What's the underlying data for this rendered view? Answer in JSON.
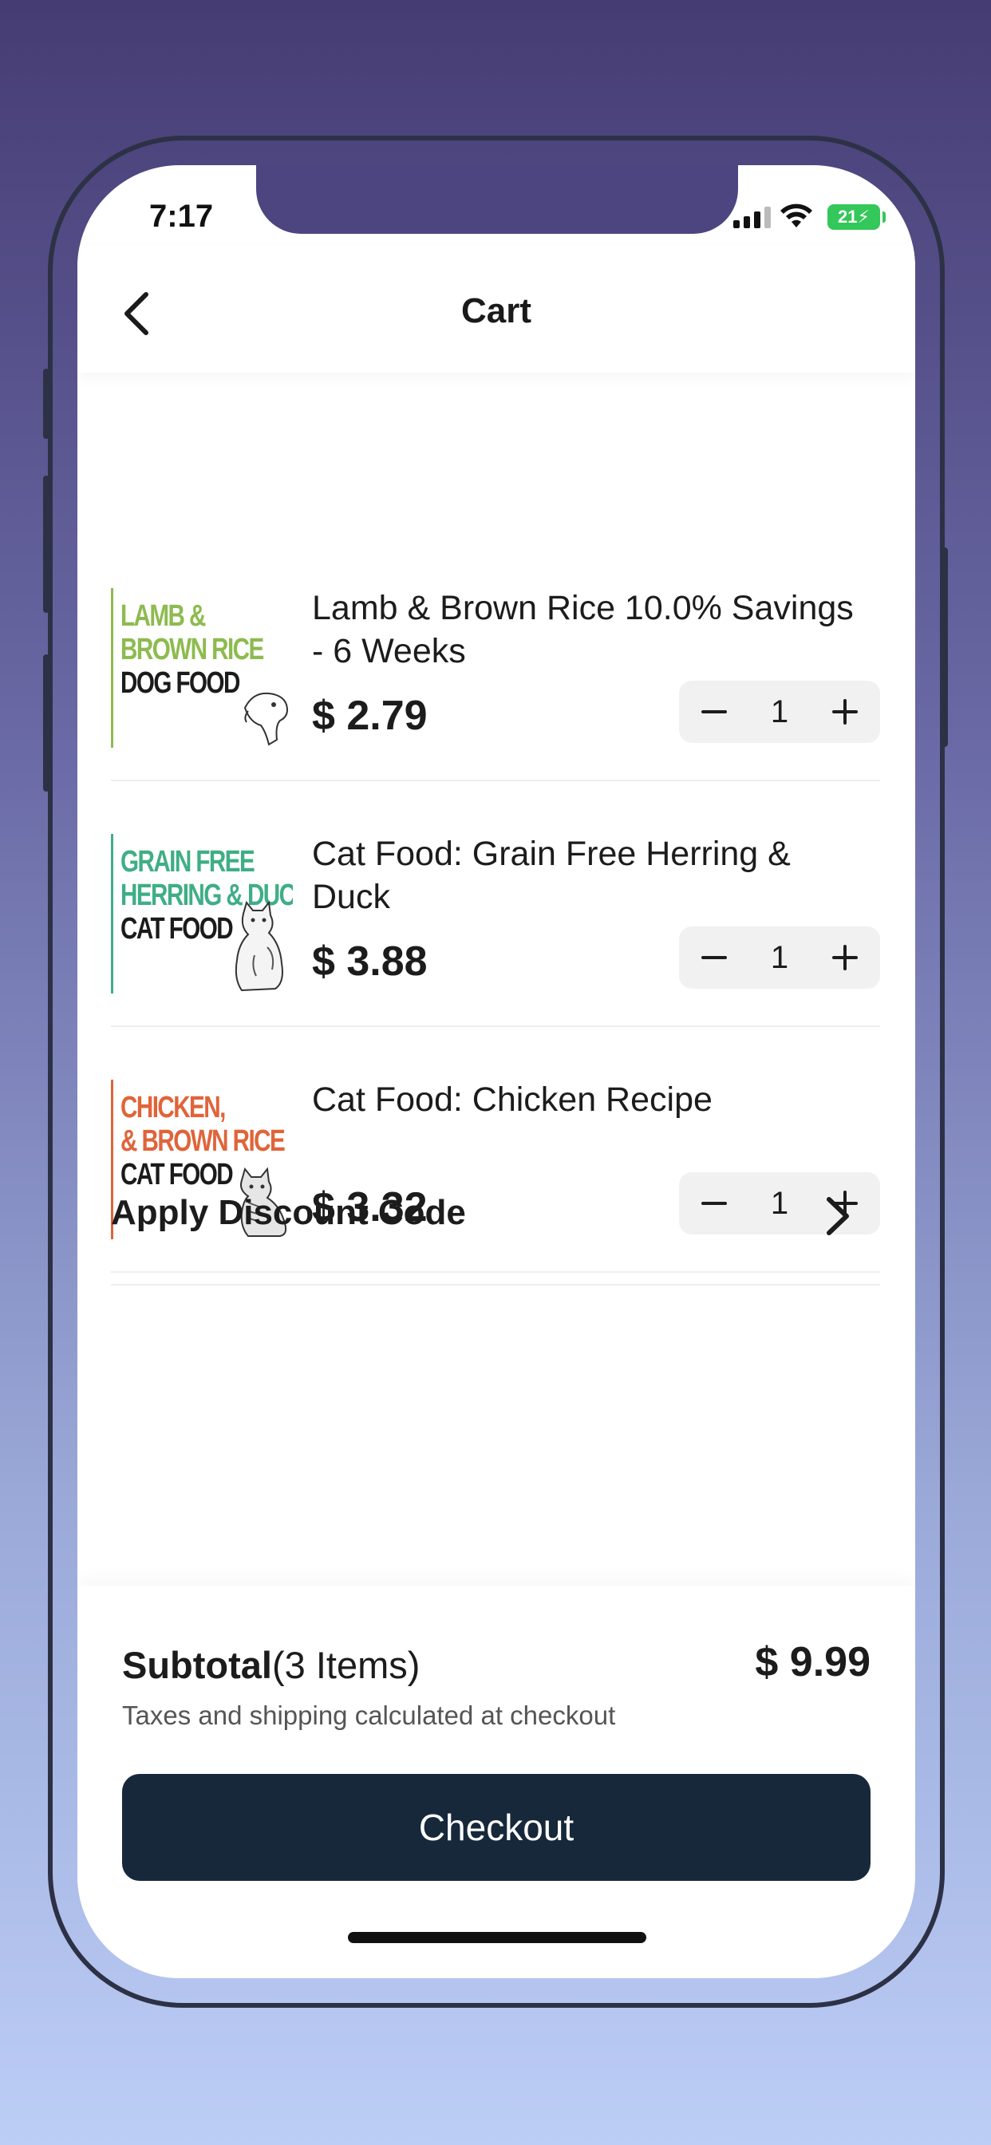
{
  "status_bar": {
    "time": "7:17",
    "battery": "21",
    "signal_icon": "cellular-signal-icon",
    "wifi_icon": "wifi-icon"
  },
  "nav": {
    "title": "Cart",
    "back_icon": "chevron-left-icon"
  },
  "cart_items": [
    {
      "name": "Lamb & Brown Rice 10.0% Savings - 6 Weeks",
      "price": "$ 2.79",
      "quantity": "1",
      "thumb": {
        "line1": "LAMB &",
        "line2": "BROWN RICE",
        "line3": "DOG FOOD",
        "accent": "#8dbb4f",
        "animal": "dog"
      }
    },
    {
      "name": "Cat Food: Grain Free Herring & Duck",
      "price": "$ 3.88",
      "quantity": "1",
      "thumb": {
        "line1": "GRAIN FREE",
        "line2": "HERRING & DUC",
        "line3": "CAT FOOD",
        "accent": "#3fae86",
        "animal": "cat"
      }
    },
    {
      "name": "Cat Food: Chicken Recipe",
      "price": "$ 3.32",
      "quantity": "1",
      "thumb": {
        "line1": "CHICKEN,",
        "line2": "& BROWN RICE",
        "line3": "CAT FOOD",
        "accent": "#e0643a",
        "animal": "cat"
      }
    }
  ],
  "discount": {
    "label": "Apply Discount Code",
    "icon": "chevron-right-icon"
  },
  "summary": {
    "subtotal_label": "Subtotal",
    "item_count": "(3 Items)",
    "subtotal_amount": "$ 9.99",
    "tax_note": "Taxes and shipping calculated at checkout",
    "checkout_label": "Checkout"
  },
  "colors": {
    "checkout_bg": "#17283a",
    "stepper_bg": "#f1f1f1",
    "battery": "#34c759"
  }
}
